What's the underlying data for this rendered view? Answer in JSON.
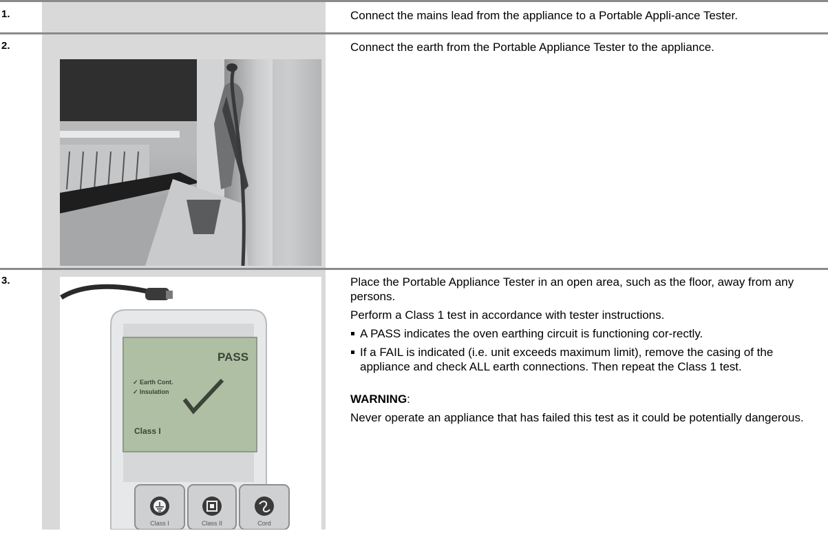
{
  "steps": [
    {
      "number": "1.",
      "text": "Connect the mains lead from the appliance to a Portable Appli-ance Tester."
    },
    {
      "number": "2.",
      "text": "Connect the earth from the Portable Appliance Tester to the appliance."
    },
    {
      "number": "3.",
      "paragraphs": [
        "Place the Portable Appliance Tester in an open area, such as the floor, away from any persons.",
        "Perform a Class 1 test in accordance with tester instructions."
      ],
      "bullets": [
        "A PASS indicates the oven earthing circuit is functioning cor-rectly.",
        "If a FAIL is indicated (i.e. unit exceeds maximum limit), remove the casing of the appliance and check ALL earth connections. Then repeat the Class 1 test."
      ],
      "warning_label": "WARNING",
      "warning_colon": ":",
      "warning_text": "Never operate an appliance that has failed this test as it could be potentially dangerous.",
      "tester_screen": {
        "status": "PASS",
        "check1": "✓ Earth Cont.",
        "check2": "✓ Insulation",
        "mode": "Class I"
      },
      "tester_buttons": [
        "Class I",
        "Class II",
        "Cord"
      ]
    }
  ]
}
